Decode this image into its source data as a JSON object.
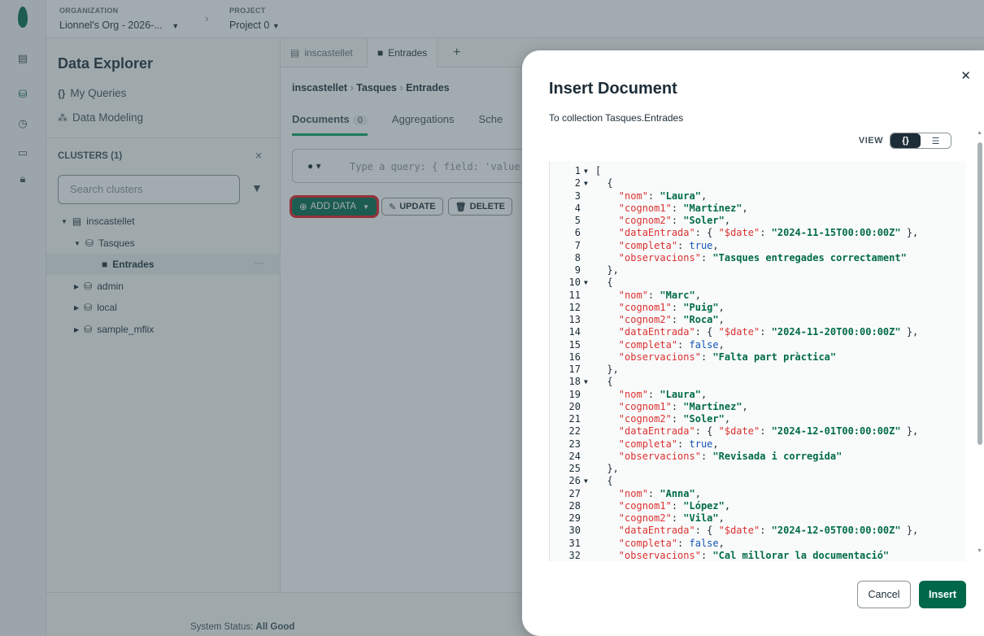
{
  "topbar": {
    "org_label": "ORGANIZATION",
    "org_value": "Lionnel's Org - 2026-...",
    "project_label": "PROJECT",
    "project_value": "Project 0"
  },
  "sidebar": {
    "title": "Data Explorer",
    "nav": [
      {
        "icon": "{}",
        "label": "My Queries"
      },
      {
        "icon": "⁂",
        "label": "Data Modeling"
      }
    ],
    "clusters_label": "CLUSTERS (1)",
    "search_placeholder": "Search clusters",
    "tree": {
      "cluster": "inscastellet",
      "db": "Tasques",
      "collection": "Entrades",
      "others": [
        "admin",
        "local",
        "sample_mflix"
      ]
    }
  },
  "main": {
    "tabs": [
      "inscastellet",
      "Entrades"
    ],
    "breadcrumb": [
      "inscastellet",
      "Tasques",
      "Entrades"
    ],
    "subtabs": [
      {
        "label": "Documents",
        "count": "0"
      },
      {
        "label": "Aggregations"
      },
      {
        "label": "Sche"
      }
    ],
    "query_placeholder": "Type a query: { field: 'value",
    "add_data": "ADD DATA",
    "update": "UPDATE",
    "delete": "DELETE"
  },
  "footer": {
    "status_prefix": "System Status: ",
    "status_value": "All Good"
  },
  "modal": {
    "title": "Insert Document",
    "subtitle": "To collection Tasques.Entrades",
    "view_label": "VIEW",
    "view_json": "{}",
    "view_list": "☰",
    "cancel": "Cancel",
    "insert": "Insert",
    "code_lines": [
      {
        "n": "1",
        "fold": true,
        "ind": 0,
        "t": [
          [
            "p",
            "["
          ]
        ]
      },
      {
        "n": "2",
        "fold": true,
        "ind": 1,
        "t": [
          [
            "p",
            "{"
          ]
        ]
      },
      {
        "n": "3",
        "ind": 2,
        "t": [
          [
            "k",
            "\"nom\""
          ],
          [
            "p",
            ": "
          ],
          [
            "s",
            "\"Laura\""
          ],
          [
            "p",
            ","
          ]
        ]
      },
      {
        "n": "4",
        "ind": 2,
        "t": [
          [
            "k",
            "\"cognom1\""
          ],
          [
            "p",
            ": "
          ],
          [
            "s",
            "\"Martínez\""
          ],
          [
            "p",
            ","
          ]
        ]
      },
      {
        "n": "5",
        "ind": 2,
        "t": [
          [
            "k",
            "\"cognom2\""
          ],
          [
            "p",
            ": "
          ],
          [
            "s",
            "\"Soler\""
          ],
          [
            "p",
            ","
          ]
        ]
      },
      {
        "n": "6",
        "ind": 2,
        "t": [
          [
            "k",
            "\"dataEntrada\""
          ],
          [
            "p",
            ": { "
          ],
          [
            "k",
            "\"$date\""
          ],
          [
            "p",
            ": "
          ],
          [
            "s",
            "\"2024-11-15T00:00:00Z\""
          ],
          [
            "p",
            " },"
          ]
        ]
      },
      {
        "n": "7",
        "ind": 2,
        "t": [
          [
            "k",
            "\"completa\""
          ],
          [
            "p",
            ": "
          ],
          [
            "b",
            "true"
          ],
          [
            "p",
            ","
          ]
        ]
      },
      {
        "n": "8",
        "ind": 2,
        "t": [
          [
            "k",
            "\"observacions\""
          ],
          [
            "p",
            ": "
          ],
          [
            "s",
            "\"Tasques entregades correctament\""
          ]
        ]
      },
      {
        "n": "9",
        "ind": 1,
        "t": [
          [
            "p",
            "},"
          ]
        ]
      },
      {
        "n": "10",
        "fold": true,
        "ind": 1,
        "t": [
          [
            "p",
            "{"
          ]
        ]
      },
      {
        "n": "11",
        "ind": 2,
        "t": [
          [
            "k",
            "\"nom\""
          ],
          [
            "p",
            ": "
          ],
          [
            "s",
            "\"Marc\""
          ],
          [
            "p",
            ","
          ]
        ]
      },
      {
        "n": "12",
        "ind": 2,
        "t": [
          [
            "k",
            "\"cognom1\""
          ],
          [
            "p",
            ": "
          ],
          [
            "s",
            "\"Puig\""
          ],
          [
            "p",
            ","
          ]
        ]
      },
      {
        "n": "13",
        "ind": 2,
        "t": [
          [
            "k",
            "\"cognom2\""
          ],
          [
            "p",
            ": "
          ],
          [
            "s",
            "\"Roca\""
          ],
          [
            "p",
            ","
          ]
        ]
      },
      {
        "n": "14",
        "ind": 2,
        "t": [
          [
            "k",
            "\"dataEntrada\""
          ],
          [
            "p",
            ": { "
          ],
          [
            "k",
            "\"$date\""
          ],
          [
            "p",
            ": "
          ],
          [
            "s",
            "\"2024-11-20T00:00:00Z\""
          ],
          [
            "p",
            " },"
          ]
        ]
      },
      {
        "n": "15",
        "ind": 2,
        "t": [
          [
            "k",
            "\"completa\""
          ],
          [
            "p",
            ": "
          ],
          [
            "b",
            "false"
          ],
          [
            "p",
            ","
          ]
        ]
      },
      {
        "n": "16",
        "ind": 2,
        "t": [
          [
            "k",
            "\"observacions\""
          ],
          [
            "p",
            ": "
          ],
          [
            "s",
            "\"Falta part pràctica\""
          ]
        ]
      },
      {
        "n": "17",
        "ind": 1,
        "t": [
          [
            "p",
            "},"
          ]
        ]
      },
      {
        "n": "18",
        "fold": true,
        "ind": 1,
        "t": [
          [
            "p",
            "{"
          ]
        ]
      },
      {
        "n": "19",
        "ind": 2,
        "t": [
          [
            "k",
            "\"nom\""
          ],
          [
            "p",
            ": "
          ],
          [
            "s",
            "\"Laura\""
          ],
          [
            "p",
            ","
          ]
        ]
      },
      {
        "n": "20",
        "ind": 2,
        "t": [
          [
            "k",
            "\"cognom1\""
          ],
          [
            "p",
            ": "
          ],
          [
            "s",
            "\"Martínez\""
          ],
          [
            "p",
            ","
          ]
        ]
      },
      {
        "n": "21",
        "ind": 2,
        "t": [
          [
            "k",
            "\"cognom2\""
          ],
          [
            "p",
            ": "
          ],
          [
            "s",
            "\"Soler\""
          ],
          [
            "p",
            ","
          ]
        ]
      },
      {
        "n": "22",
        "ind": 2,
        "t": [
          [
            "k",
            "\"dataEntrada\""
          ],
          [
            "p",
            ": { "
          ],
          [
            "k",
            "\"$date\""
          ],
          [
            "p",
            ": "
          ],
          [
            "s",
            "\"2024-12-01T00:00:00Z\""
          ],
          [
            "p",
            " },"
          ]
        ]
      },
      {
        "n": "23",
        "ind": 2,
        "t": [
          [
            "k",
            "\"completa\""
          ],
          [
            "p",
            ": "
          ],
          [
            "b",
            "true"
          ],
          [
            "p",
            ","
          ]
        ]
      },
      {
        "n": "24",
        "ind": 2,
        "t": [
          [
            "k",
            "\"observacions\""
          ],
          [
            "p",
            ": "
          ],
          [
            "s",
            "\"Revisada i corregida\""
          ]
        ]
      },
      {
        "n": "25",
        "ind": 1,
        "t": [
          [
            "p",
            "},"
          ]
        ]
      },
      {
        "n": "26",
        "fold": true,
        "ind": 1,
        "t": [
          [
            "p",
            "{"
          ]
        ]
      },
      {
        "n": "27",
        "ind": 2,
        "t": [
          [
            "k",
            "\"nom\""
          ],
          [
            "p",
            ": "
          ],
          [
            "s",
            "\"Anna\""
          ],
          [
            "p",
            ","
          ]
        ]
      },
      {
        "n": "28",
        "ind": 2,
        "t": [
          [
            "k",
            "\"cognom1\""
          ],
          [
            "p",
            ": "
          ],
          [
            "s",
            "\"López\""
          ],
          [
            "p",
            ","
          ]
        ]
      },
      {
        "n": "29",
        "ind": 2,
        "t": [
          [
            "k",
            "\"cognom2\""
          ],
          [
            "p",
            ": "
          ],
          [
            "s",
            "\"Vila\""
          ],
          [
            "p",
            ","
          ]
        ]
      },
      {
        "n": "30",
        "ind": 2,
        "t": [
          [
            "k",
            "\"dataEntrada\""
          ],
          [
            "p",
            ": { "
          ],
          [
            "k",
            "\"$date\""
          ],
          [
            "p",
            ": "
          ],
          [
            "s",
            "\"2024-12-05T00:00:00Z\""
          ],
          [
            "p",
            " },"
          ]
        ]
      },
      {
        "n": "31",
        "ind": 2,
        "t": [
          [
            "k",
            "\"completa\""
          ],
          [
            "p",
            ": "
          ],
          [
            "b",
            "false"
          ],
          [
            "p",
            ","
          ]
        ]
      },
      {
        "n": "32",
        "ind": 2,
        "t": [
          [
            "k",
            "\"observacions\""
          ],
          [
            "p",
            ": "
          ],
          [
            "s",
            "\"Cal millorar la documentació\""
          ]
        ]
      }
    ]
  }
}
